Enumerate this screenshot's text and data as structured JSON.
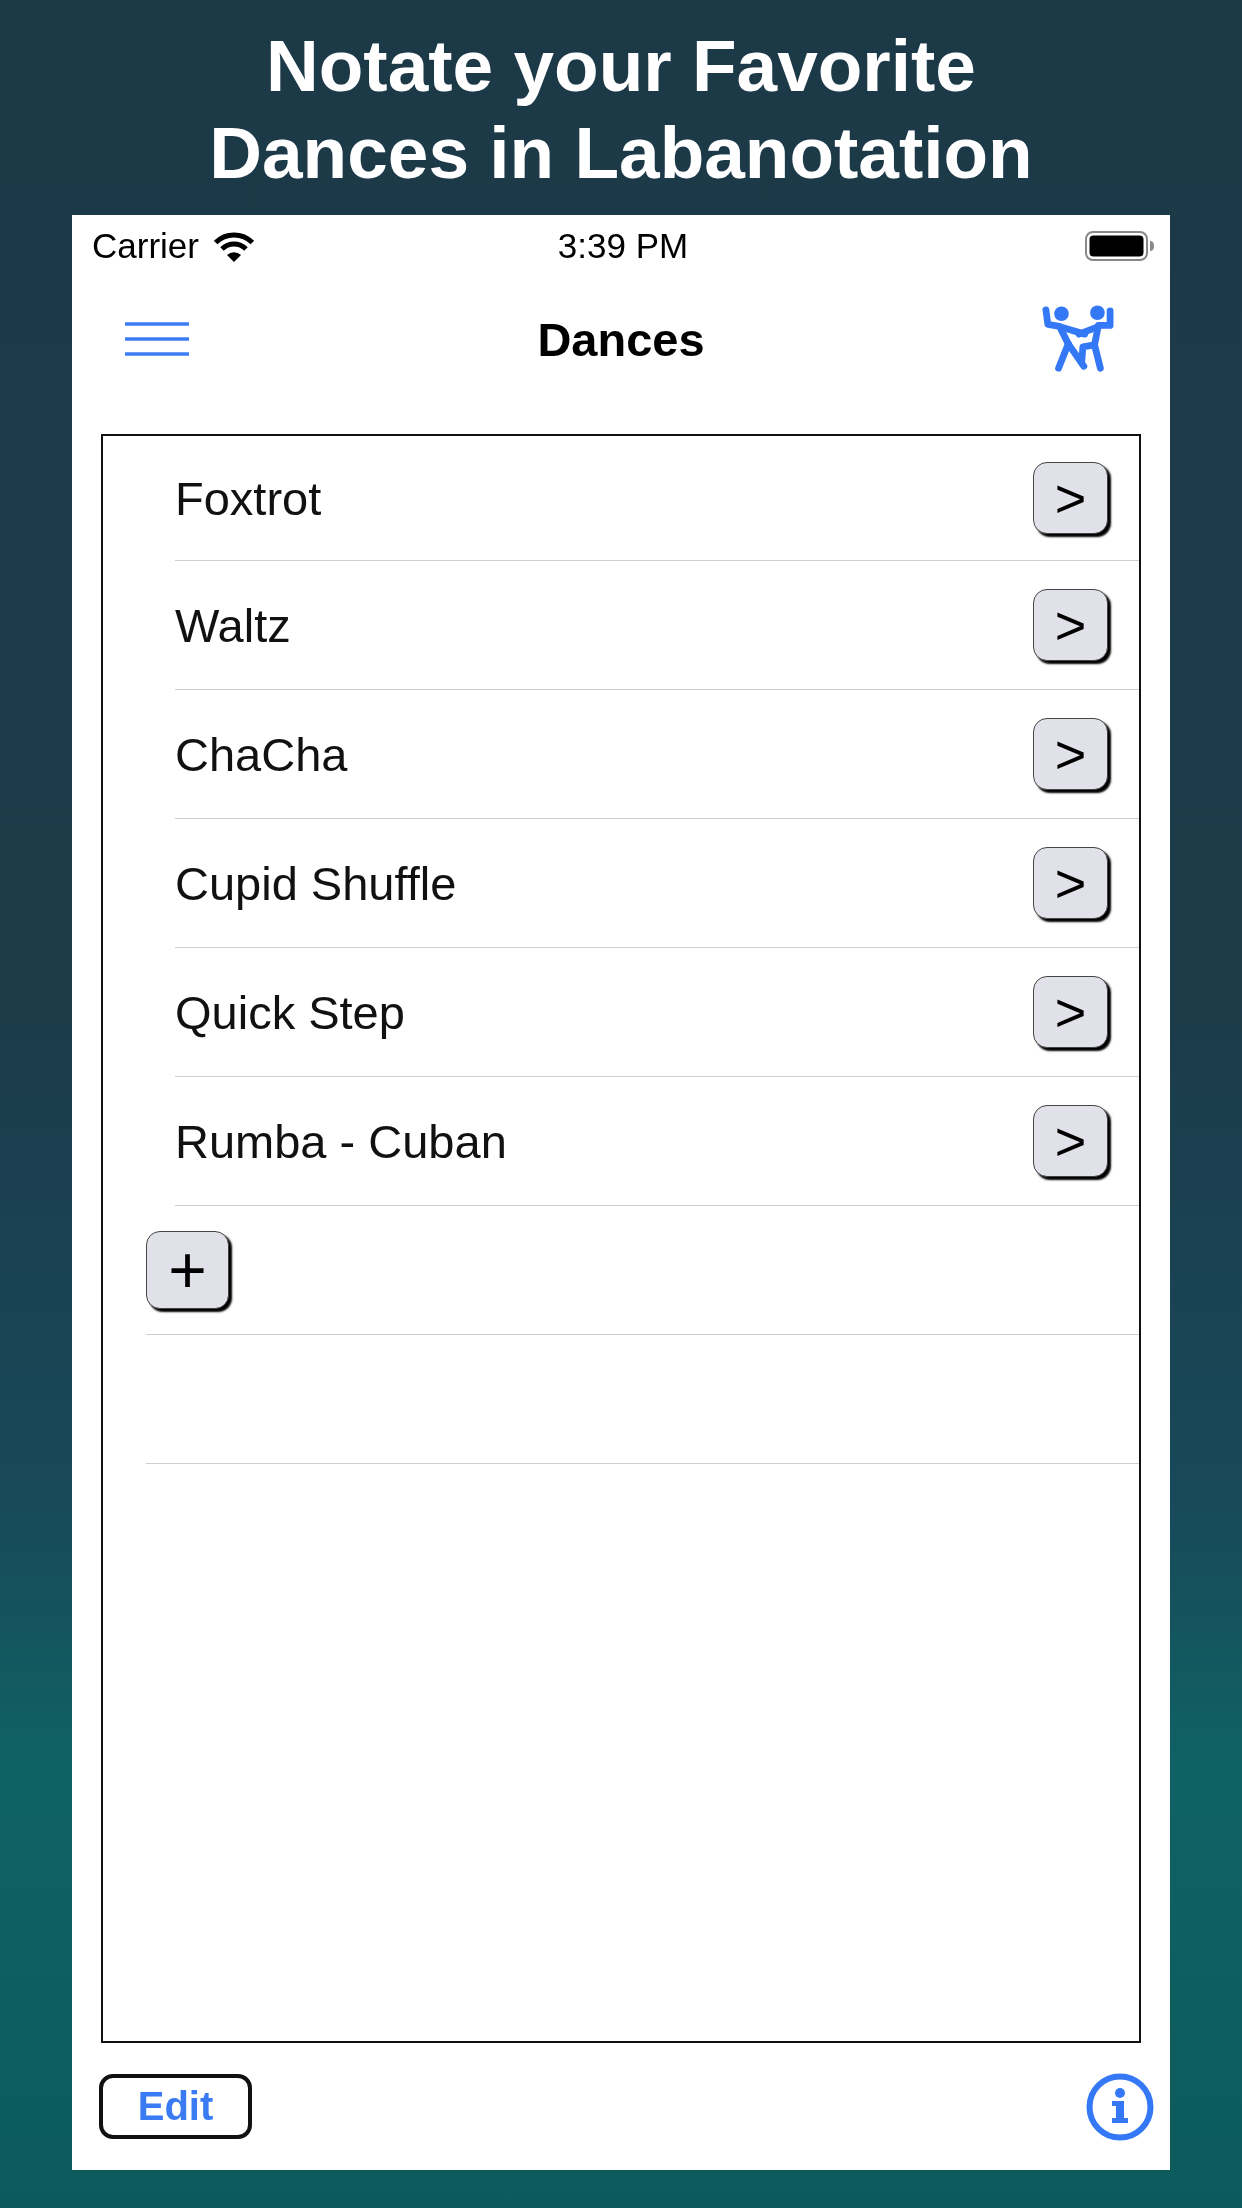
{
  "headline": "Notate your Favorite Dances in Labanotation",
  "status_bar": {
    "carrier": "Carrier",
    "time": "3:39 PM"
  },
  "nav_bar": {
    "title": "Dances"
  },
  "dances": [
    {
      "name": "Foxtrot",
      "action": ">"
    },
    {
      "name": "Waltz",
      "action": ">"
    },
    {
      "name": "ChaCha",
      "action": ">"
    },
    {
      "name": "Cupid Shuffle",
      "action": ">"
    },
    {
      "name": "Quick Step",
      "action": ">"
    },
    {
      "name": "Rumba - Cuban",
      "action": ">"
    }
  ],
  "add_button": "+",
  "toolbar": {
    "edit_button": "Edit"
  }
}
